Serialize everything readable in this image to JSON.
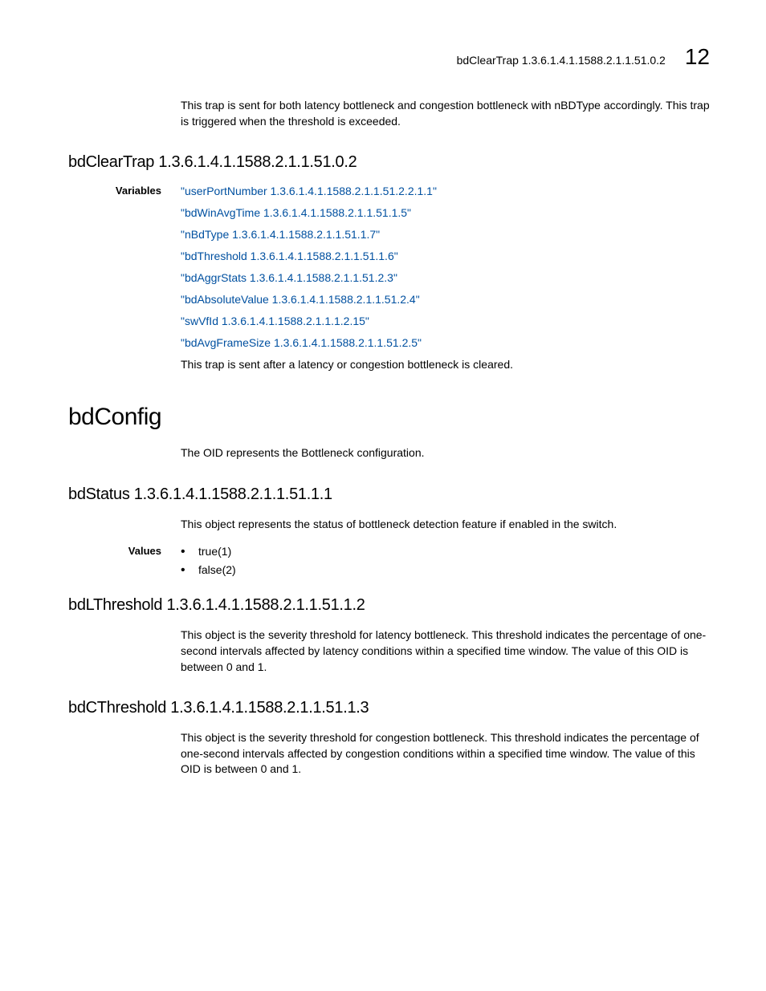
{
  "header": {
    "text": "bdClearTrap 1.3.6.1.4.1.1588.2.1.1.51.0.2",
    "page_number": "12"
  },
  "intro_paragraph": "This trap is sent for both latency bottleneck and congestion bottleneck with nBDType accordingly. This trap is triggered when the threshold is exceeded.",
  "section_bdcleartrap": {
    "title": "bdClearTrap 1.3.6.1.4.1.1588.2.1.1.51.0.2",
    "label": "Variables",
    "links": [
      "\"userPortNumber 1.3.6.1.4.1.1588.2.1.1.51.2.2.1.1\"",
      "\"bdWinAvgTime 1.3.6.1.4.1.1588.2.1.1.51.1.5\"",
      "\"nBdType 1.3.6.1.4.1.1588.2.1.1.51.1.7\"",
      "\"bdThreshold 1.3.6.1.4.1.1588.2.1.1.51.1.6\"",
      "\"bdAggrStats 1.3.6.1.4.1.1588.2.1.1.51.2.3\"",
      "\"bdAbsoluteValue 1.3.6.1.4.1.1588.2.1.1.51.2.4\"",
      "\"swVfId 1.3.6.1.4.1.1588.2.1.1.1.2.15\"",
      "\"bdAvgFrameSize 1.3.6.1.4.1.1588.2.1.1.51.2.5\""
    ],
    "trailing": "This trap is sent after a latency or congestion bottleneck is cleared."
  },
  "section_bdconfig": {
    "title": "bdConfig",
    "desc": "The OID represents the Bottleneck configuration."
  },
  "section_bdstatus": {
    "title": "bdStatus 1.3.6.1.4.1.1588.2.1.1.51.1.1",
    "desc": "This object represents the status of bottleneck detection feature if enabled in the switch.",
    "label": "Values",
    "values": [
      "true(1)",
      "false(2)"
    ]
  },
  "section_bdlthreshold": {
    "title": "bdLThreshold 1.3.6.1.4.1.1588.2.1.1.51.1.2",
    "desc": "This object is the severity threshold for latency bottleneck. This threshold indicates the percentage of one-second intervals affected by latency conditions within a specified time window. The value of this OID is between 0 and 1."
  },
  "section_bdcthreshold": {
    "title": "bdCThreshold 1.3.6.1.4.1.1588.2.1.1.51.1.3",
    "desc": "This object is the severity threshold for congestion bottleneck. This threshold indicates the percentage of one-second intervals affected by congestion conditions within a specified time window. The value of this OID is between 0 and 1."
  }
}
